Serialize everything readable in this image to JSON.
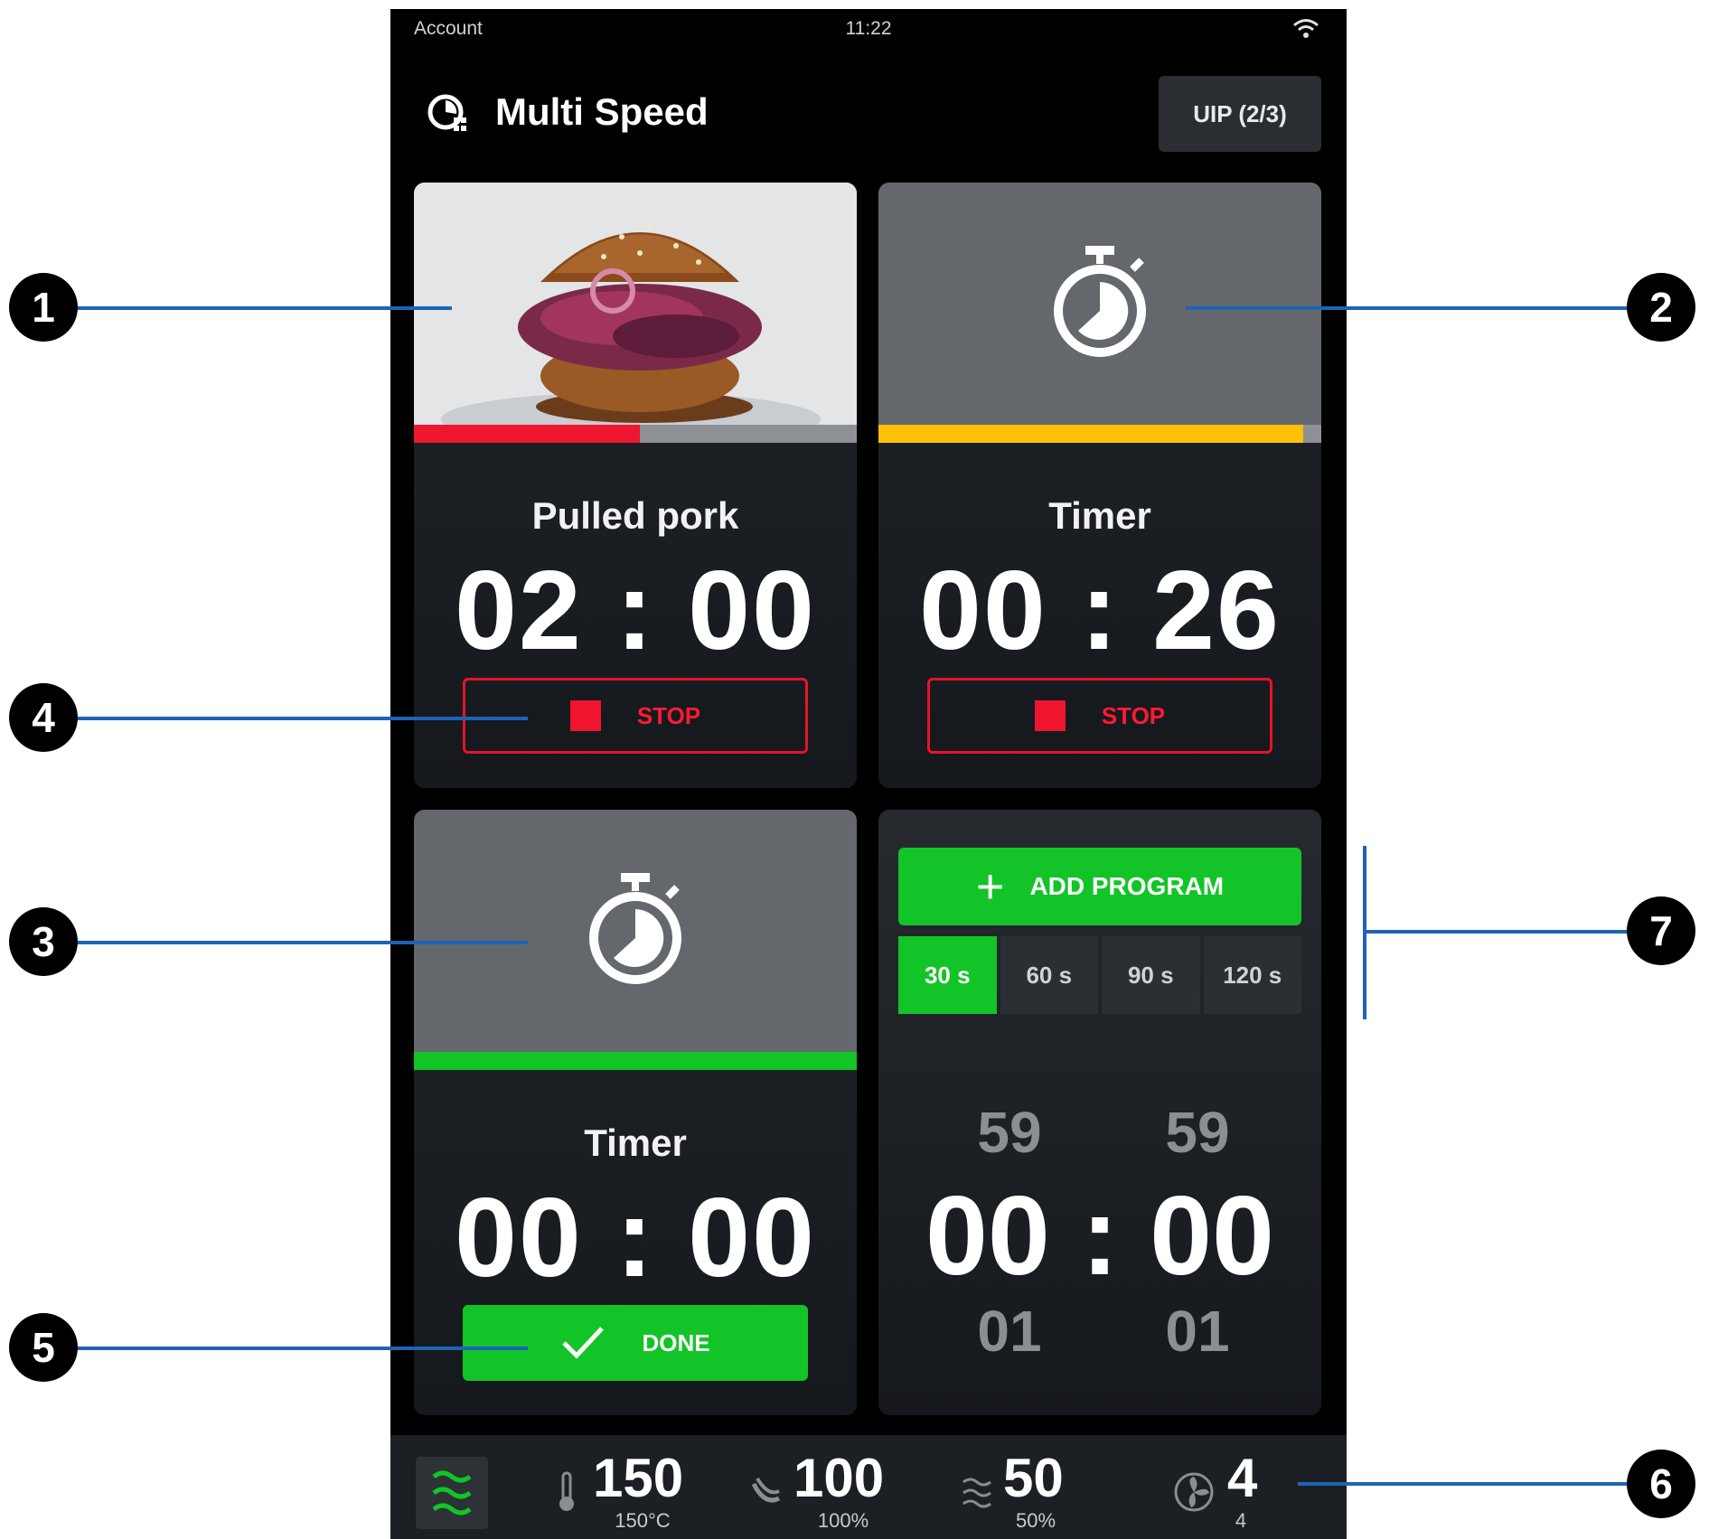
{
  "status_bar": {
    "account": "Account",
    "time": "11:22"
  },
  "header": {
    "title": "Multi Speed",
    "uip_label": "UIP (2/3)"
  },
  "cards": [
    {
      "name": "Pulled pork",
      "time": "02 : 00",
      "action": "STOP",
      "progress": 0.51,
      "progress_color": "#ee1730"
    },
    {
      "name": "Timer",
      "time": "00 : 26",
      "action": "STOP",
      "progress": 0.96,
      "progress_color": "#ffc107"
    },
    {
      "name": "Timer",
      "time": "00 : 00",
      "action": "DONE",
      "progress": 1.0,
      "progress_color": "#12c428"
    }
  ],
  "program_panel": {
    "add_label": "ADD PROGRAM",
    "presets": [
      "30 s",
      "60 s",
      "90 s",
      "120 s"
    ],
    "active_preset": "30 s",
    "picker": {
      "above": [
        "59",
        "59"
      ],
      "current": "00 : 00",
      "below": [
        "01",
        "01"
      ]
    }
  },
  "bottom_bar": {
    "temperature": {
      "value": "150",
      "sub": "150°C"
    },
    "microwave": {
      "value": "100",
      "sub": "100%"
    },
    "steam": {
      "value": "50",
      "sub": "50%"
    },
    "fan": {
      "value": "4",
      "sub": "4"
    }
  },
  "callouts": [
    "1",
    "2",
    "3",
    "4",
    "5",
    "6",
    "7"
  ],
  "colors": {
    "accent_green": "#12c428",
    "stop_red": "#ee1730",
    "timer_yellow": "#ffc107",
    "callout_blue": "#1d64b5"
  }
}
